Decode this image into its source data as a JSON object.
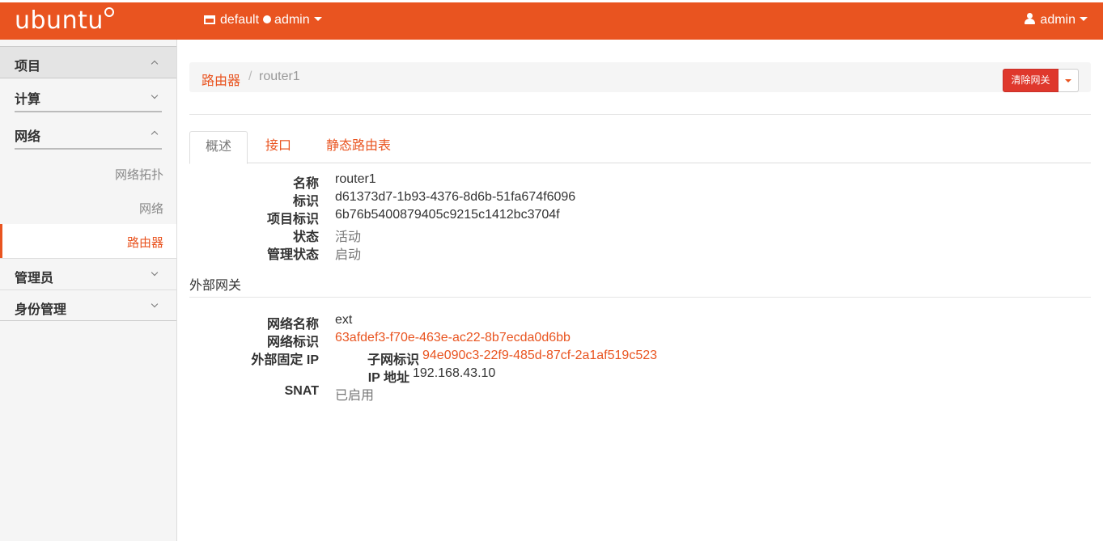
{
  "topbar": {
    "brand": "ubuntu",
    "project_label": "default",
    "user_scope": "admin",
    "user_name": "admin"
  },
  "sidebar": {
    "project": "项目",
    "compute": "计算",
    "network": "网络",
    "network_items": [
      "网络拓扑",
      "网络",
      "路由器"
    ],
    "admin": "管理员",
    "identity": "身份管理"
  },
  "breadcrumb": {
    "parent": "路由器",
    "separator": "/",
    "current": "router1"
  },
  "actions": {
    "clear_gateway": "清除网关"
  },
  "tabs": [
    "概述",
    "接口",
    "静态路由表"
  ],
  "overview": {
    "name_label": "名称",
    "name_value": "router1",
    "id_label": "标识",
    "id_value": "d61373d7-1b93-4376-8d6b-51fa674f6096",
    "project_id_label": "项目标识",
    "project_id_value": "6b76b5400879405c9215c1412bc3704f",
    "status_label": "状态",
    "status_value": "活动",
    "admin_state_label": "管理状态",
    "admin_state_value": "启动"
  },
  "gateway": {
    "section_title": "外部网关",
    "network_name_label": "网络名称",
    "network_name_value": "ext",
    "network_id_label": "网络标识",
    "network_id_value": "63afdef3-f70e-463e-ac22-8b7ecda0d6bb",
    "fixed_ip_label": "外部固定 IP",
    "subnet_id_label": "子网标识",
    "subnet_id_value": "94e090c3-22f9-485d-87cf-2a1af519c523",
    "ip_label": "IP 地址",
    "ip_value": "192.168.43.10",
    "snat_label": "SNAT",
    "snat_value": "已启用"
  },
  "colors": {
    "accent": "#e95420",
    "danger": "#df382c"
  }
}
